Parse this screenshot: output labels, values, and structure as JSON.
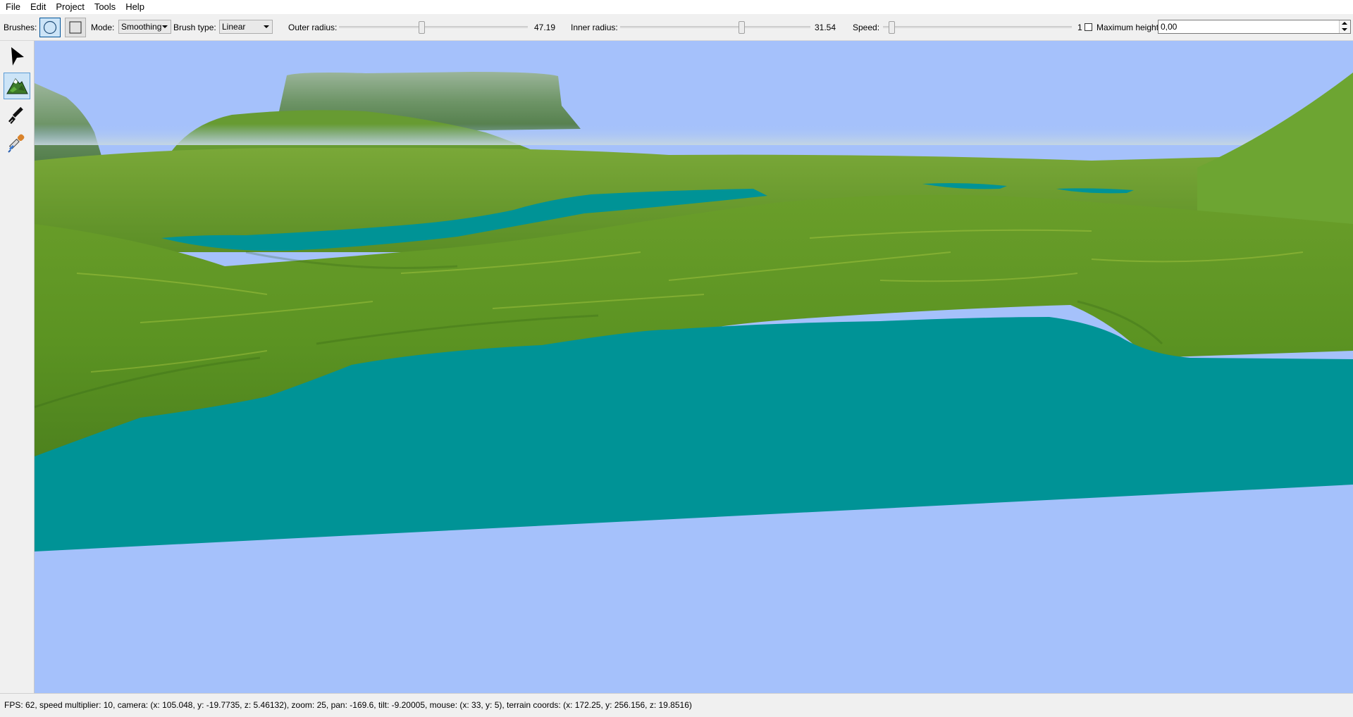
{
  "menu": [
    "File",
    "Edit",
    "Project",
    "Tools",
    "Help"
  ],
  "toolbar": {
    "brushes_label": "Brushes:",
    "mode_label": "Mode:",
    "mode_value": "Smoothing",
    "brush_type_label": "Brush type:",
    "brush_type_value": "Linear",
    "outer_radius_label": "Outer radius:",
    "outer_radius_value": "47.19",
    "outer_radius_level": 0.44,
    "inner_radius_label": "Inner radius:",
    "inner_radius_value": "31.54",
    "inner_radius_level": 0.64,
    "speed_label": "Speed:",
    "speed_value": "1",
    "speed_level": 0.05,
    "max_height_label": "Maximum height:",
    "max_height_value": "0,00"
  },
  "tools": [
    {
      "name": "select-tool",
      "icon": "arrow-cursor-icon"
    },
    {
      "name": "terrain-tool",
      "icon": "mountain-icon",
      "active": true
    },
    {
      "name": "paint-tool",
      "icon": "paintbrush-icon"
    },
    {
      "name": "eyedropper-tool",
      "icon": "eyedropper-icon"
    }
  ],
  "colors": {
    "sky": "#a5c1fb",
    "water": "#009396",
    "grass": "#5a9a22",
    "selection": "#cce4f7"
  },
  "status": "FPS: 62, speed multiplier: 10, camera: (x: 105.048, y: -19.7735, z: 5.46132), zoom: 25, pan: -169.6, tilt: -9.20005, mouse: (x: 33, y: 5), terrain coords: (x: 172.25, y: 256.156, z: 19.8516)"
}
